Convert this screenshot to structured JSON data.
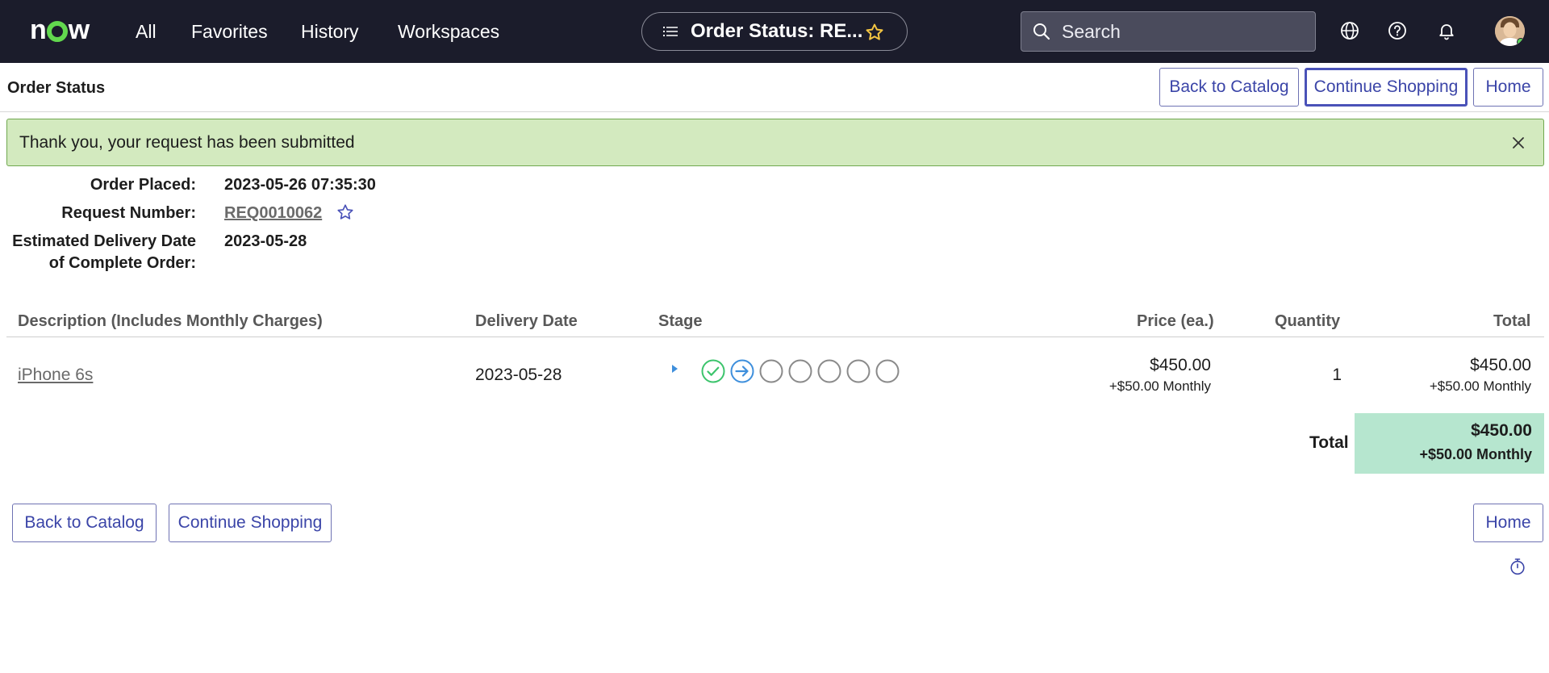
{
  "nav": {
    "logo_text_1": "n",
    "logo_text_2": "w",
    "links": [
      "All",
      "Favorites",
      "History",
      "Workspaces"
    ],
    "page_pill_title": "Order Status: RE...",
    "search_placeholder": "Search"
  },
  "header": {
    "page_title": "Order Status",
    "buttons": [
      "Back to Catalog",
      "Continue Shopping",
      "Home"
    ]
  },
  "alert": {
    "message": "Thank you, your request has been submitted"
  },
  "order": {
    "placed_label": "Order Placed:",
    "placed_value": "2023-05-26 07:35:30",
    "request_label": "Request Number:",
    "request_value": "REQ0010062",
    "delivery_label_1": "Estimated Delivery Date",
    "delivery_label_2": "of Complete Order:",
    "delivery_value": "2023-05-28"
  },
  "table": {
    "headers": [
      "Description (Includes Monthly Charges)",
      "Delivery Date",
      "Stage",
      "Price (ea.)",
      "Quantity",
      "Total"
    ],
    "rows": [
      {
        "description": "iPhone 6s",
        "delivery_date": "2023-05-28",
        "stages": [
          "completed",
          "in-progress",
          "pending",
          "pending",
          "pending",
          "pending",
          "pending"
        ],
        "price": "$450.00",
        "price_monthly": "+$50.00 Monthly",
        "quantity": "1",
        "total": "$450.00",
        "total_monthly": "+$50.00 Monthly"
      }
    ],
    "total_label": "Total",
    "grand_total": "$450.00",
    "grand_total_monthly": "+$50.00 Monthly"
  },
  "footer": {
    "buttons": [
      "Back to Catalog",
      "Continue Shopping",
      "Home"
    ]
  },
  "colors": {
    "nav_bg": "#1b1c2b",
    "accent": "#3b45a8",
    "alert_bg": "#d3eabf",
    "total_bg": "#b6e6cf",
    "stage_done": "#3cc46c",
    "stage_active": "#3e8fdc",
    "stage_pending": "#8a8a8a"
  },
  "icons": [
    "list-icon",
    "star-icon",
    "search-icon",
    "globe-icon",
    "help-icon",
    "bell-icon",
    "close-icon",
    "play-icon",
    "check-circle-icon",
    "arrow-circle-icon",
    "empty-circle-icon",
    "stopwatch-icon"
  ]
}
